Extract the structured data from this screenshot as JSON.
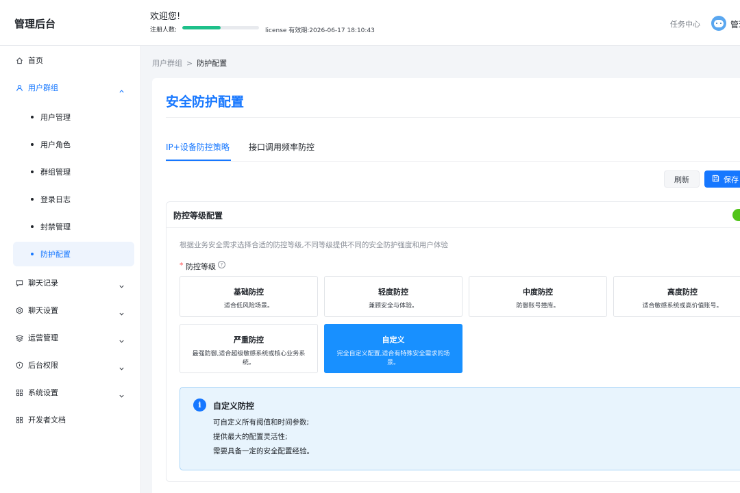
{
  "header": {
    "app_title": "管理后台",
    "welcome": "欢迎您!",
    "registered_label": "注册人数:",
    "registered_progress_percent": 50,
    "license_text": "license 有效期:2026-06-17 18:10:43",
    "task_center": "任务中心",
    "user_name": "管理"
  },
  "sidebar": {
    "items": [
      {
        "label": "首页",
        "icon": "home-icon"
      },
      {
        "label": "用户群组",
        "icon": "user-icon",
        "expanded": true
      },
      {
        "label": "聊天记录",
        "icon": "chat-icon"
      },
      {
        "label": "聊天设置",
        "icon": "settings-icon"
      },
      {
        "label": "运营管理",
        "icon": "layers-icon"
      },
      {
        "label": "后台权限",
        "icon": "shield-icon"
      },
      {
        "label": "系统设置",
        "icon": "grid-icon"
      },
      {
        "label": "开发者文档",
        "icon": "grid-icon"
      }
    ],
    "user_group_children": [
      {
        "label": "用户管理"
      },
      {
        "label": "用户角色"
      },
      {
        "label": "群组管理"
      },
      {
        "label": "登录日志"
      },
      {
        "label": "封禁管理"
      },
      {
        "label": "防护配置",
        "active": true
      }
    ]
  },
  "breadcrumb": {
    "parent": "用户群组",
    "separator": ">",
    "current": "防护配置"
  },
  "page": {
    "title": "安全防护配置",
    "tabs": [
      {
        "label": "IP+设备防控策略",
        "active": true
      },
      {
        "label": "接口调用频率防控",
        "active": false
      }
    ],
    "refresh_label": "刷新",
    "save_label": "保存"
  },
  "level_panel": {
    "title": "防控等级配置",
    "description": "根据业务安全需求选择合适的防控等级,不同等级提供不同的安全防护强度和用户体验",
    "field_label": "防控等级",
    "required_mark": "*",
    "help_glyph": "?",
    "levels": [
      {
        "name": "基础防控",
        "desc": "适合低风险场景。"
      },
      {
        "name": "轻度防控",
        "desc": "兼顾安全与体验。"
      },
      {
        "name": "中度防控",
        "desc": "防御账号撞库。"
      },
      {
        "name": "高度防控",
        "desc": "适合敏感系统或高价值账号。"
      },
      {
        "name": "严重防控",
        "desc": "最强防御,适合超级敏感系统或核心业务系统。"
      },
      {
        "name": "自定义",
        "desc": "完全自定义配置,适合有特殊安全需求的场景。",
        "selected": true
      }
    ]
  },
  "info_box": {
    "icon_glyph": "i",
    "title": "自定义防控",
    "lines": [
      "可自定义所有阈值和时间参数;",
      "提供最大的配置灵活性;",
      "需要具备一定的安全配置经验。"
    ]
  },
  "colors": {
    "accent": "#1677ff",
    "selected_card": "#1890ff",
    "progress": "#1ec08a",
    "info_bg": "#e8f4fd"
  }
}
